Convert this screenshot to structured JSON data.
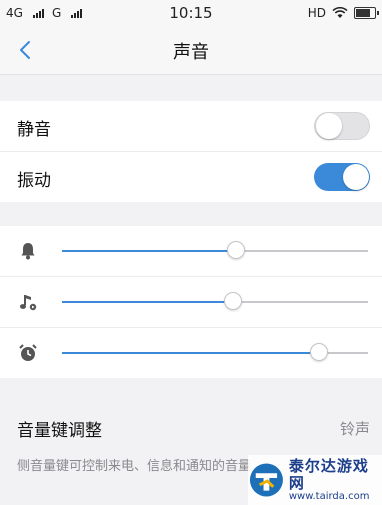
{
  "status_bar": {
    "network_1": "4G",
    "network_2": "G",
    "time": "10:15",
    "hd": "HD",
    "battery_level_percent": 80
  },
  "header": {
    "title": "声音",
    "back_icon": "chevron-left-icon"
  },
  "toggles": [
    {
      "label": "静音",
      "on": false
    },
    {
      "label": "振动",
      "on": true
    }
  ],
  "volumes": [
    {
      "icon": "bell-icon",
      "level_percent": 57
    },
    {
      "icon": "music-note-icon",
      "level_percent": 56
    },
    {
      "icon": "alarm-clock-icon",
      "level_percent": 84
    }
  ],
  "volume_key": {
    "label": "音量键调整",
    "value": "铃声",
    "description": "侧音量键可控制来电、信息和通知的音量"
  },
  "watermark": {
    "line1": "泰尔达游戏网",
    "line2": "www.tairda.com"
  },
  "colors": {
    "accent": "#3b8ad9",
    "background": "#f2f2f4"
  }
}
